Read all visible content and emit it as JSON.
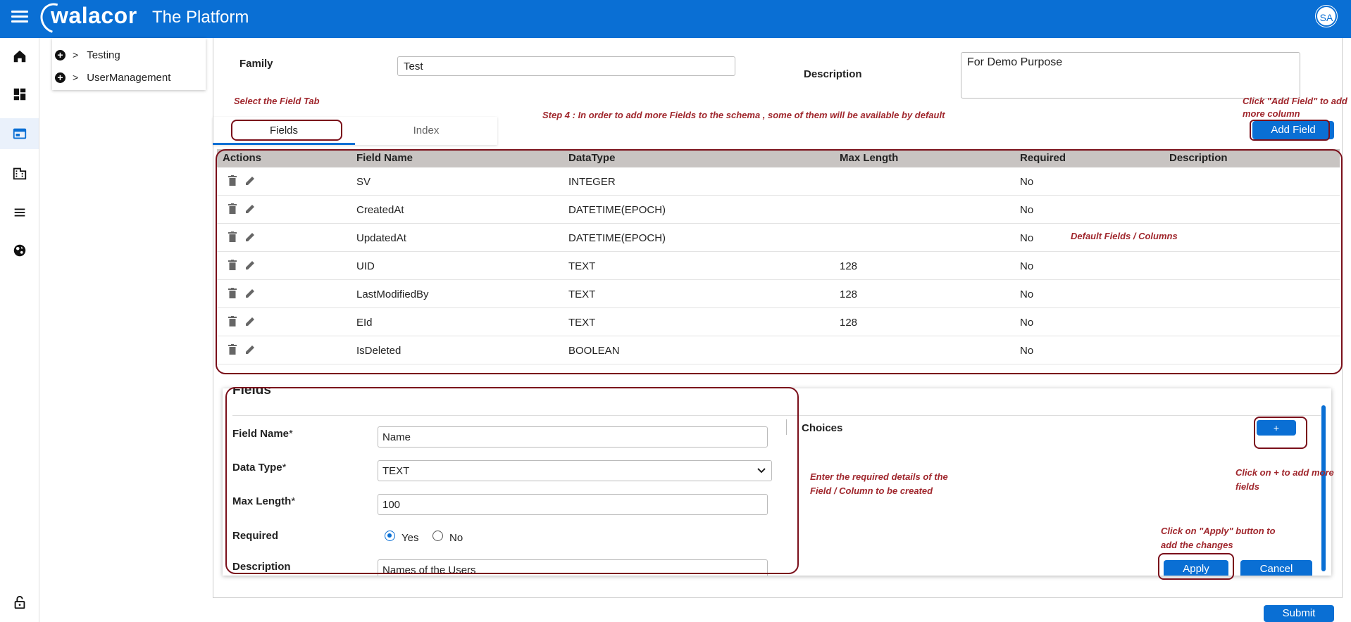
{
  "app": {
    "logo_text": "walacor",
    "title": "The Platform",
    "avatar_initials": "SA"
  },
  "nav": {
    "icons": [
      "home-icon",
      "dashboard-icon",
      "schema-icon",
      "building-icon",
      "list-icon",
      "globe-icon",
      "lock-icon"
    ],
    "active": "schema-icon"
  },
  "tree": {
    "items": [
      {
        "label": "Testing"
      },
      {
        "label": "UserManagement"
      }
    ]
  },
  "form": {
    "family_label": "Family",
    "family_value": "Test",
    "description_label": "Description",
    "description_value": "For Demo Purpose"
  },
  "tabs": {
    "fields": "Fields",
    "index": "Index"
  },
  "buttons": {
    "add_field": "Add Field",
    "add_choice": "+",
    "apply": "Apply",
    "cancel": "Cancel",
    "submit": "Submit"
  },
  "notes": {
    "select_tab": "Select the Field Tab",
    "step4": "Step 4 : In order to add more Fields to the schema , some of them will be available by default",
    "add_field": "Click \"Add Field\" to add more column",
    "default_fields": "Default Fields / Columns",
    "enter_details": "Enter the required details of the Field / Column to be created",
    "click_plus": "Click on + to add more fields",
    "click_apply": "Click on \"Apply\" button to add the changes"
  },
  "table": {
    "headers": [
      "Actions",
      "Field Name",
      "DataType",
      "Max Length",
      "Required",
      "Description"
    ],
    "rows": [
      {
        "field": "SV",
        "type": "INTEGER",
        "max": "",
        "required": "No"
      },
      {
        "field": "CreatedAt",
        "type": "DATETIME(EPOCH)",
        "max": "",
        "required": "No"
      },
      {
        "field": "UpdatedAt",
        "type": "DATETIME(EPOCH)",
        "max": "",
        "required": "No"
      },
      {
        "field": "UID",
        "type": "TEXT",
        "max": "128",
        "required": "No"
      },
      {
        "field": "LastModifiedBy",
        "type": "TEXT",
        "max": "128",
        "required": "No"
      },
      {
        "field": "EId",
        "type": "TEXT",
        "max": "128",
        "required": "No"
      },
      {
        "field": "IsDeleted",
        "type": "BOOLEAN",
        "max": "",
        "required": "No"
      }
    ]
  },
  "field_form": {
    "title": "Fields",
    "field_name_label": "Field Name",
    "field_name_value": "Name",
    "data_type_label": "Data Type",
    "data_type_value": "TEXT",
    "max_length_label": "Max Length",
    "max_length_value": "100",
    "required_label": "Required",
    "yes_label": "Yes",
    "no_label": "No",
    "description_label": "Description",
    "description_value": "Names of the Users",
    "choices_label": "Choices",
    "asterisk": "*"
  },
  "colors": {
    "primary": "#0a6fd4",
    "annotation": "#a0272d",
    "outline": "#7a0f1a"
  }
}
